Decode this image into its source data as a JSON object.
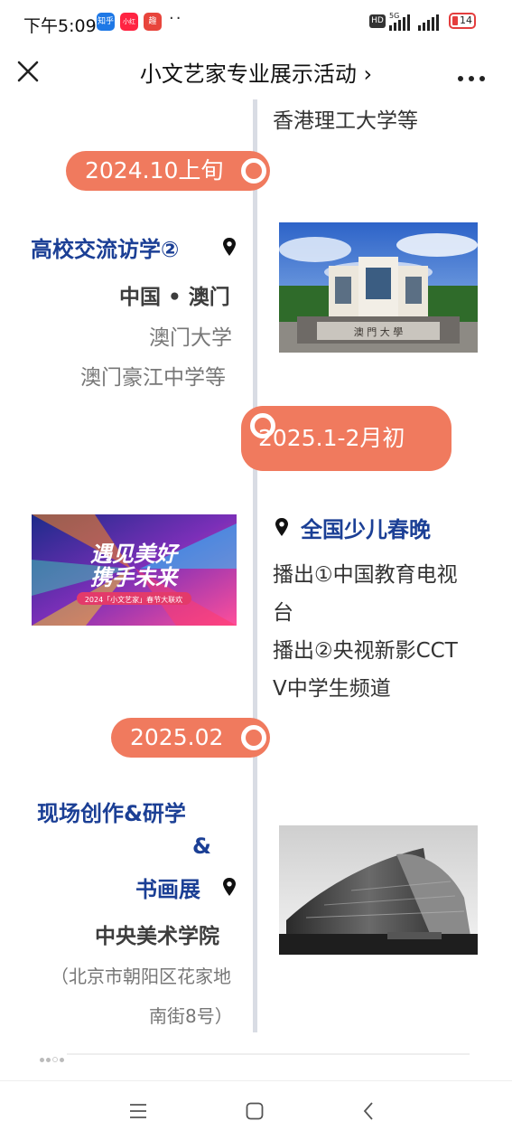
{
  "status_bar": {
    "time": "下午5:09",
    "apps": [
      {
        "label": "知乎",
        "color": "#1e78e6"
      },
      {
        "label": "小红书",
        "color": "#ff2442"
      },
      {
        "label": "趣",
        "color": "#e8453c"
      }
    ],
    "more": "··",
    "hd": "HD",
    "network": "5G",
    "battery": "14"
  },
  "nav": {
    "title": "小文艺家专业展示活动 ›"
  },
  "timeline": {
    "top_partial_text": "香港理工大学等",
    "events": [
      {
        "date": "2024.10上旬",
        "title": "高校交流访学②",
        "location": "中国 • 澳门",
        "details": [
          "澳门大学",
          "澳门豪江中学等"
        ]
      },
      {
        "date": "2025.1-2月初",
        "title": "全国少儿春晚",
        "lines": [
          "播出①中国教育电视",
          "台",
          "播出②央视新影CCT",
          "V中学生频道"
        ],
        "banner": {
          "line1": "遇见美好",
          "line2": "携手未来",
          "caption": "2024「小文艺家」春节大联欢"
        }
      },
      {
        "date": "2025.02",
        "title_lines": [
          "现场创作&研学",
          "&",
          "书画展"
        ],
        "location": "中央美术学院",
        "details": [
          "（北京市朝阳区花家地",
          "南街8号）"
        ]
      }
    ],
    "photo_sign": "澳 門 大 學"
  }
}
